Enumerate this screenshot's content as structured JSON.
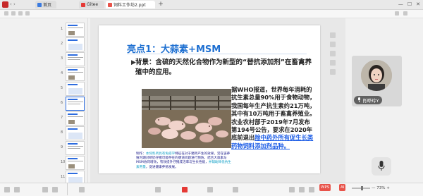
{
  "tabs": {
    "home_label": "首页",
    "tab1_label": "Gitee",
    "tab2_label": "饲料工作坊2.ppt",
    "add": "+"
  },
  "window_buttons": {
    "minimize": "—",
    "maximize": "☐",
    "close": "✕"
  },
  "nav": "‹ ›",
  "thumbnails": {
    "numbers": [
      "1",
      "2",
      "3",
      "4",
      "5",
      "6",
      "7",
      "8",
      "9",
      "10",
      "11"
    ],
    "active_index": 5
  },
  "slide": {
    "title": "亮点1：大蒜素+MSM",
    "bullet": "▶",
    "background_text": "背景：含硫的天然化合物作为新型的“替抗添加剂”在畜禽养殖中的应用。",
    "caption_intro": "制作：",
    "caption_cyan1": "本饲料所具有免疫学",
    "caption_mid1": "特征在对于猪",
    "caption_body": "所产生的效果，常在该养殖时期对断奶仔猪可能存在的肠道问题进行预防，结合大蒜素与MSM协同增效，有效提升仔猪成活率与生长性能，",
    "caption_cyan2": "并辅助降低抗生素用量",
    "caption_end": "，促进健康养殖发展。",
    "who_text_prefix": "据WHO报道，世界每年消耗的抗生素总量90%用于食物动物，我国每年生产抗生素约21万吨，其中有10万吨用于畜禽养殖业。农业农村部于2019年7月发布第194号公告，要求在2020年底前退出",
    "who_text_highlight": "除中药外所有促生长类药物饲料添加剂品种。"
  },
  "video": {
    "name": "肖晔玲Y"
  },
  "status": {
    "logo": "WPS",
    "logo2": "AI",
    "zoom": "— 73% +"
  },
  "colors": {
    "title_blue": "#1d6fd1",
    "highlight_blue": "#1e5ee6",
    "caption_navy": "#1b1b8a",
    "caption_cyan": "#17a2c8",
    "active_thumb": "#2d6cdf"
  },
  "icons": {
    "mic": "microphone-icon",
    "video_mic": "microphone-icon",
    "app": "wps-logo-icon"
  }
}
